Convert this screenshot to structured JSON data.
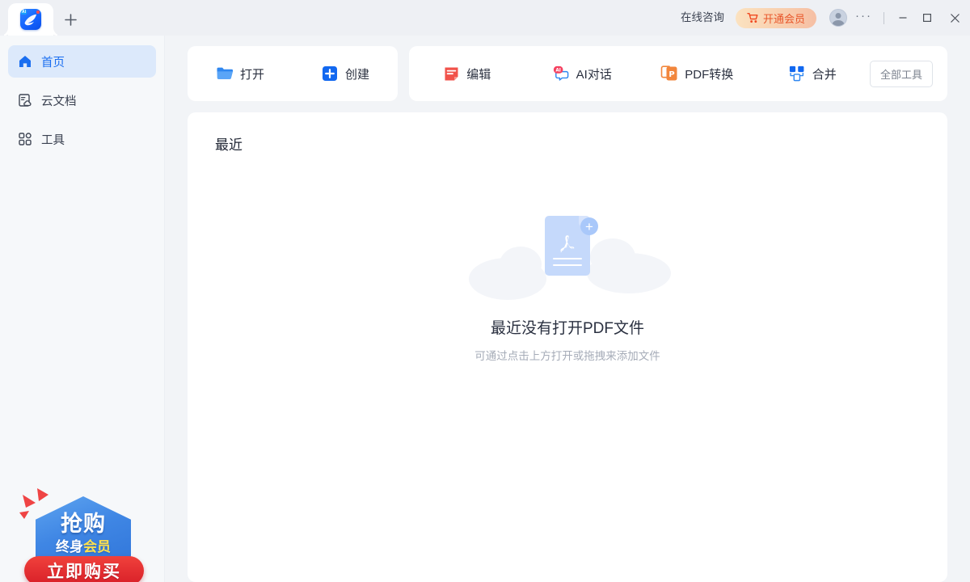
{
  "window": {
    "tab": {
      "logo_label": "app-logo",
      "ai_badge": "AI"
    },
    "new_tab_label": "+",
    "consult_label": "在线咨询",
    "vip_label": "开通会员",
    "more_label": "···",
    "minimize_label": "—",
    "maximize_label": "▢",
    "close_label": "✕"
  },
  "sidebar": {
    "items": [
      {
        "label": "首页",
        "icon": "home-icon",
        "active": true
      },
      {
        "label": "云文档",
        "icon": "cloud-document-icon",
        "active": false
      },
      {
        "label": "工具",
        "icon": "grid-tools-icon",
        "active": false
      }
    ],
    "promo": {
      "line1": "抢购",
      "line2_white": "终身",
      "line2_yellow": "会员",
      "cta": "立即购买"
    }
  },
  "toolbar": {
    "primary": [
      {
        "label": "打开",
        "icon": "folder-open-icon"
      },
      {
        "label": "创建",
        "icon": "plus-square-icon"
      }
    ],
    "secondary": [
      {
        "label": "编辑",
        "icon": "edit-document-icon"
      },
      {
        "label": "AI对话",
        "icon": "ai-chat-icon"
      },
      {
        "label": "PDF转换",
        "icon": "pdf-convert-icon"
      },
      {
        "label": "合并",
        "icon": "merge-icon"
      }
    ],
    "all_tools_label": "全部工具"
  },
  "recent": {
    "title": "最近",
    "empty_title": "最近没有打开PDF文件",
    "empty_subtitle": "可通过点击上方打开或拖拽来添加文件",
    "plus_badge": "+"
  },
  "colors": {
    "accent_blue": "#1a6ef0",
    "sidebar_active_bg": "#dce9fb",
    "page_bg": "#f2f4f7",
    "vip_text": "#e8562a",
    "promo_red": "#d81f28",
    "promo_blue": "#3f86e4"
  }
}
